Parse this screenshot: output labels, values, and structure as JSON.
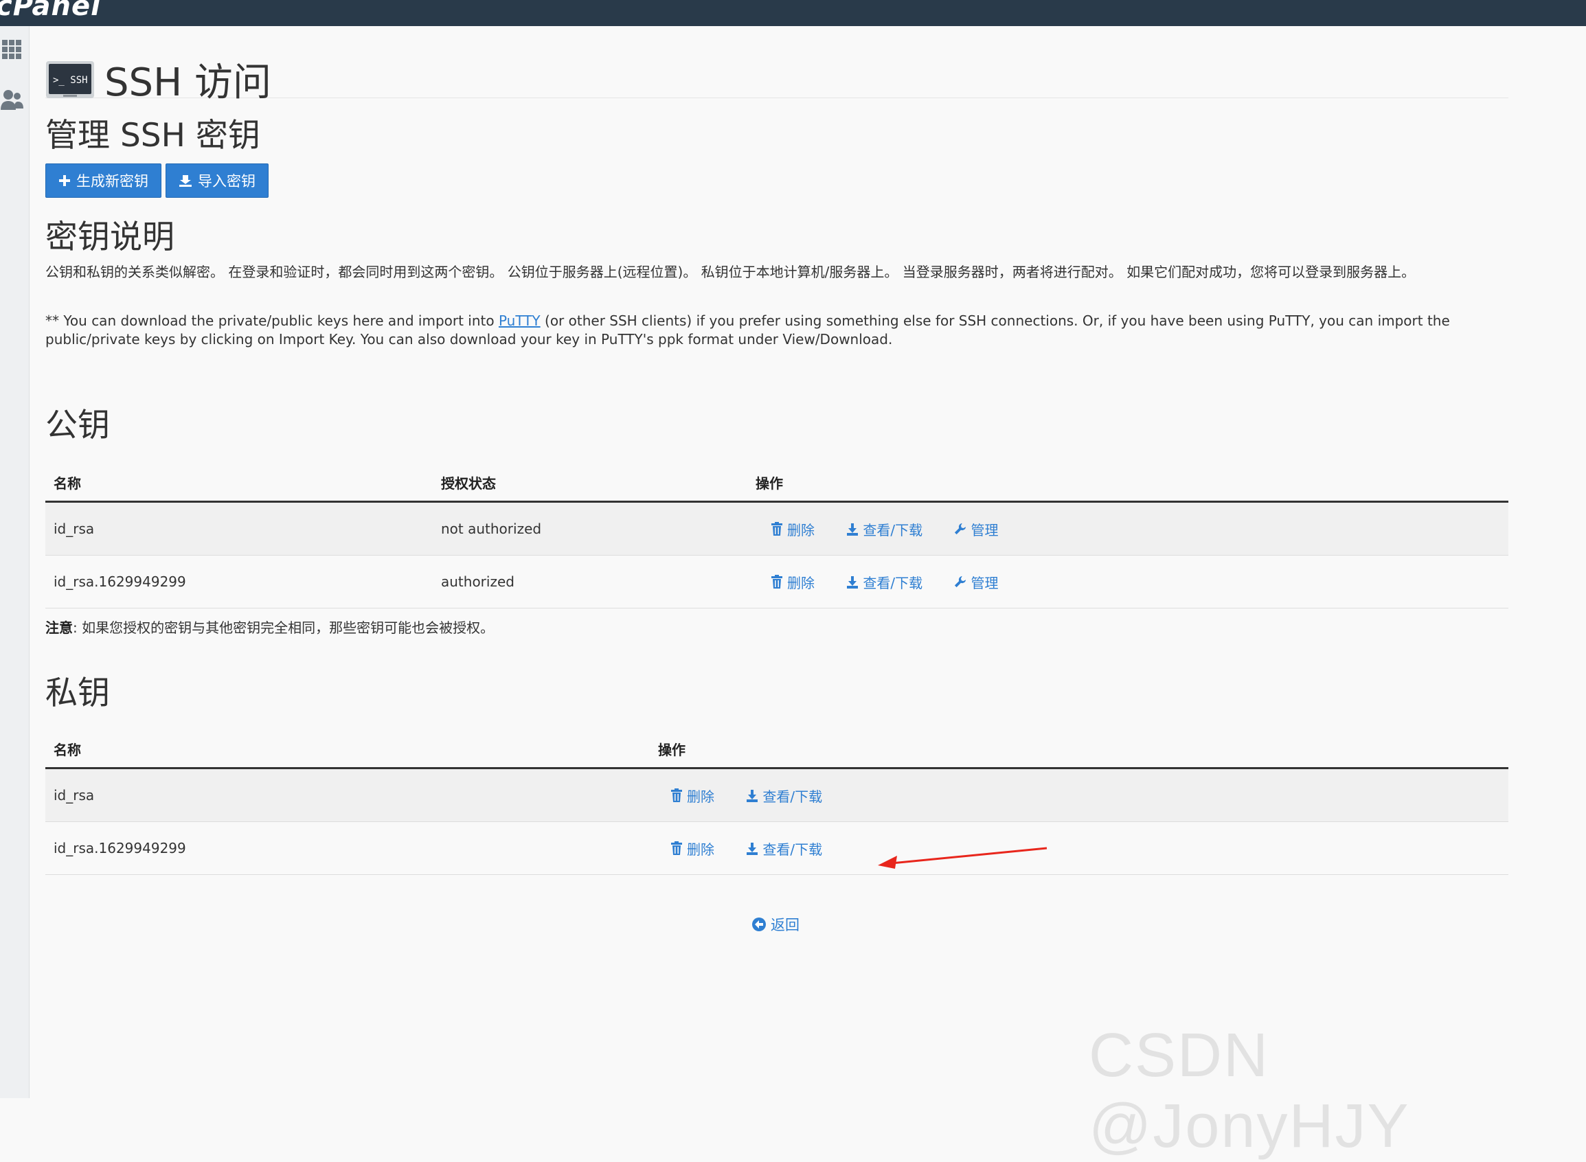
{
  "brand": "cPanel",
  "page": {
    "title": "SSH 访问",
    "icon_label": ">_ SSH"
  },
  "manage": {
    "heading": "管理 SSH 密钥",
    "generate_button": "生成新密钥",
    "import_button": "导入密钥"
  },
  "description": {
    "heading": "密钥说明",
    "paragraph1": "公钥和私钥的关系类似解密。 在登录和验证时，都会同时用到这两个密钥。 公钥位于服务器上(远程位置)。 私钥位于本地计算机/服务器上。 当登录服务器时，两者将进行配对。 如果它们配对成功，您将可以登录到服务器上。",
    "paragraph2_before": "** You can download the private/public keys here and import into ",
    "paragraph2_link": "PuTTY",
    "paragraph2_after": " (or other SSH clients) if you prefer using something else for SSH connections. Or, if you have been using PuTTY, you can import the public/private keys by clicking on Import Key. You can also download your key in PuTTY's ppk format under View/Download."
  },
  "public_keys": {
    "heading": "公钥",
    "columns": {
      "name": "名称",
      "status": "授权状态",
      "actions": "操作"
    },
    "rows": [
      {
        "name": "id_rsa",
        "status": "not authorized",
        "delete": "删除",
        "view": "查看/下载",
        "manage": "管理"
      },
      {
        "name": "id_rsa.1629949299",
        "status": "authorized",
        "delete": "删除",
        "view": "查看/下载",
        "manage": "管理"
      }
    ]
  },
  "note": {
    "label": "注意",
    "text": ": 如果您授权的密钥与其他密钥完全相同，那些密钥可能也会被授权。"
  },
  "private_keys": {
    "heading": "私钥",
    "columns": {
      "name": "名称",
      "actions": "操作"
    },
    "rows": [
      {
        "name": "id_rsa",
        "delete": "删除",
        "view": "查看/下载"
      },
      {
        "name": "id_rsa.1629949299",
        "delete": "删除",
        "view": "查看/下载"
      }
    ]
  },
  "back_link": "返回",
  "watermark": "CSDN @JonyHJY",
  "colors": {
    "topbar": "#293a4a",
    "accent": "#2f7fd2",
    "arrow": "#e8261c"
  }
}
